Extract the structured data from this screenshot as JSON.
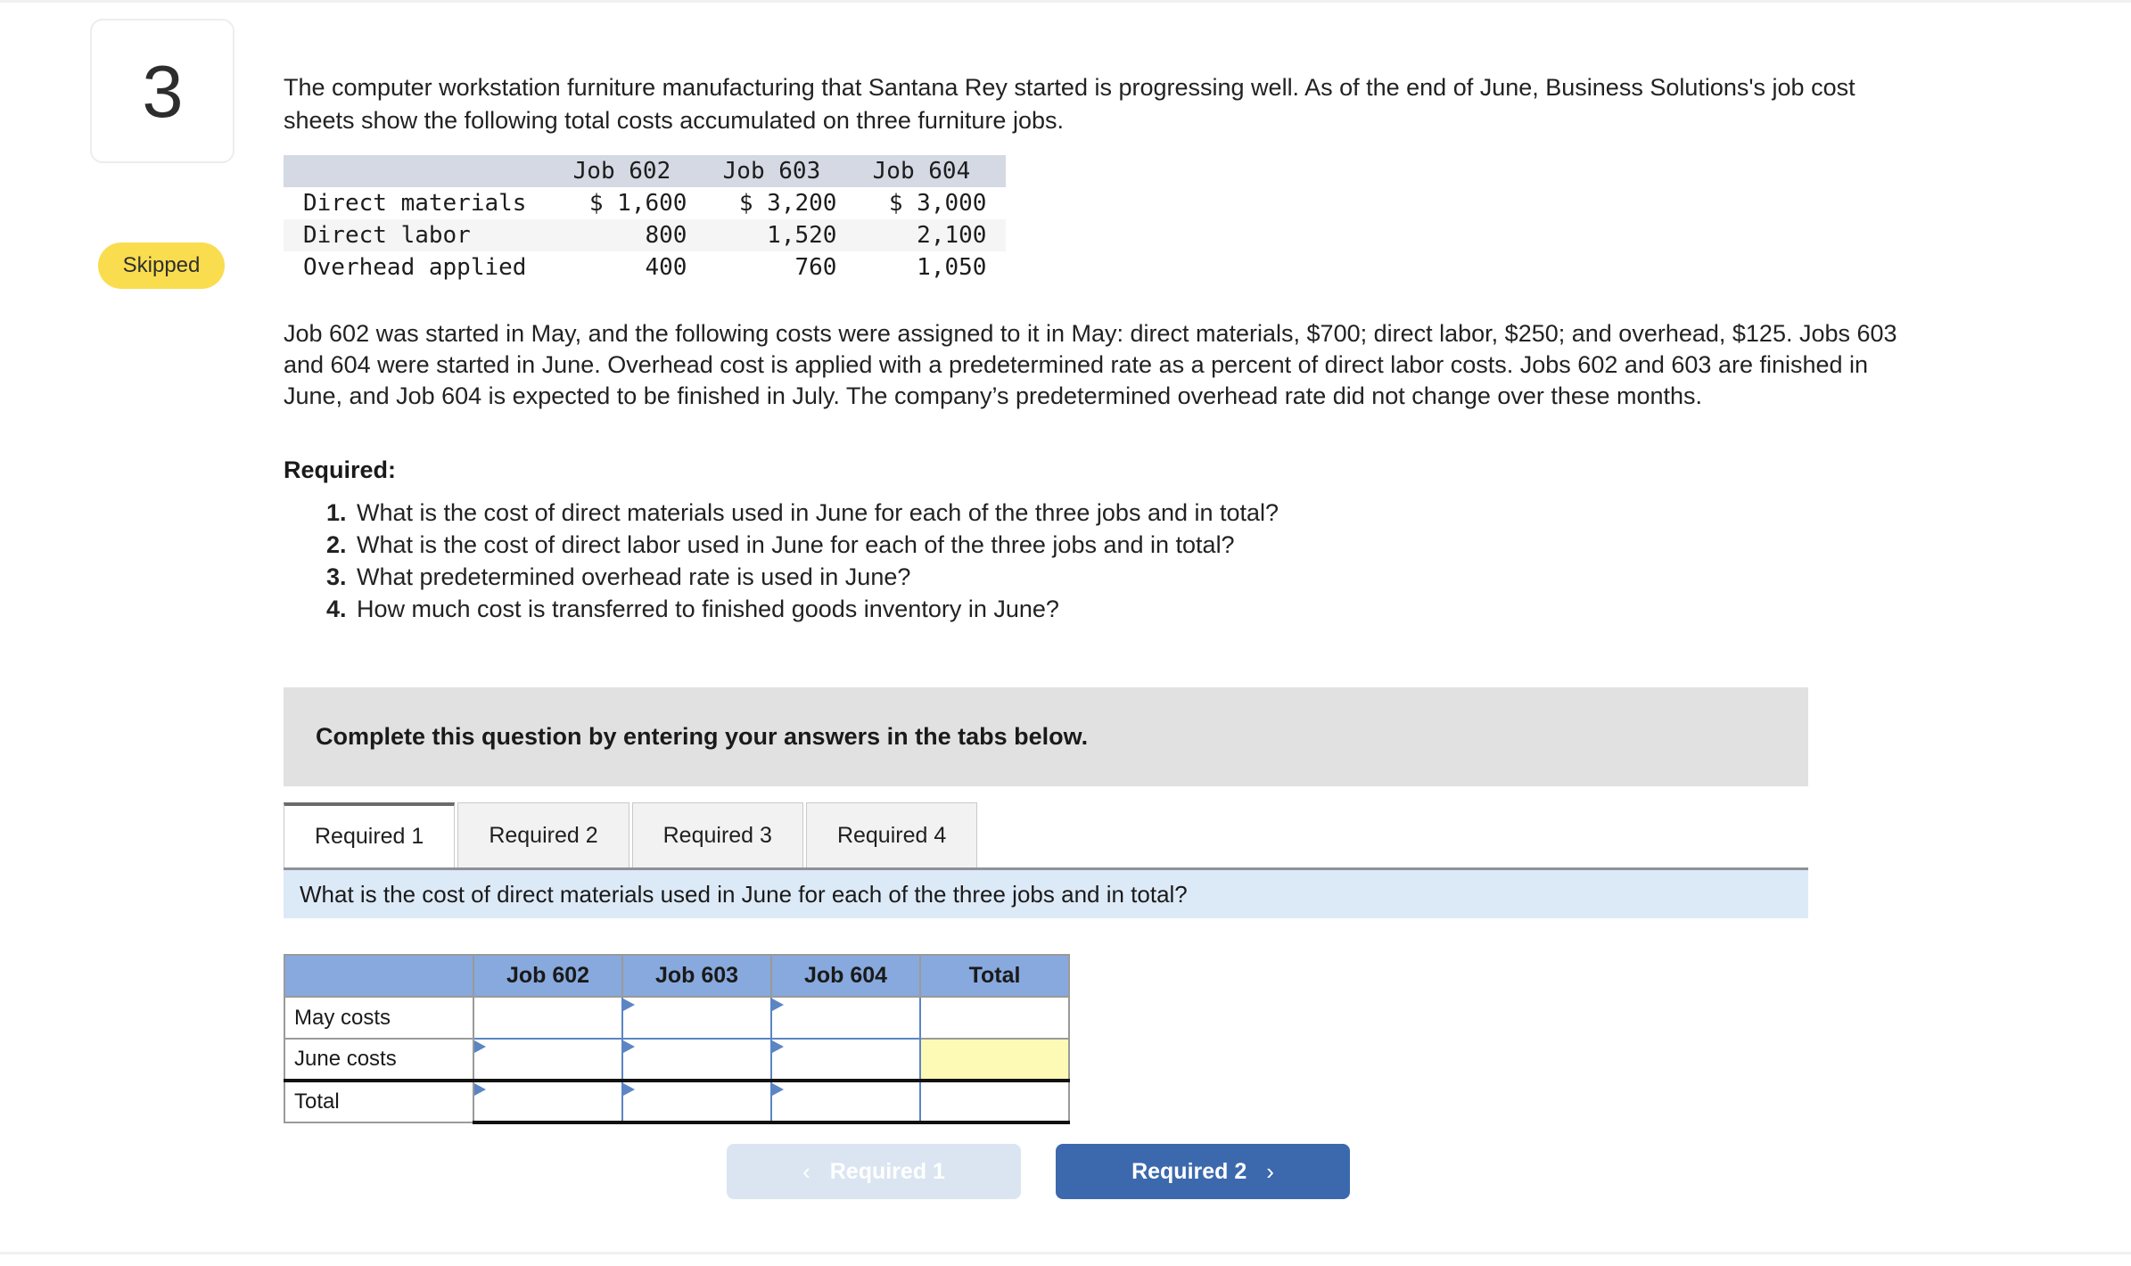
{
  "question": {
    "number": "3",
    "status_label": "Skipped"
  },
  "intro_paragraph": "The computer workstation furniture manufacturing that Santana Rey started is progressing well. As of the end of June, Business Solutions's job cost sheets show the following total costs accumulated on three furniture jobs.",
  "cost_table": {
    "headers": [
      "",
      "Job 602",
      "Job 603",
      "Job 604"
    ],
    "rows": [
      {
        "label": "Direct materials",
        "values": [
          "$ 1,600",
          "$ 3,200",
          "$ 3,000"
        ]
      },
      {
        "label": "Direct labor",
        "values": [
          "800",
          "1,520",
          "2,100"
        ]
      },
      {
        "label": "Overhead applied",
        "values": [
          "400",
          "760",
          "1,050"
        ]
      }
    ]
  },
  "body_paragraph": "Job 602 was started in May, and the following costs were assigned to it in May: direct materials, $700; direct labor, $250; and overhead, $125. Jobs 603 and 604 were started in June. Overhead cost is applied with a predetermined rate as a percent of direct labor costs. Jobs 602 and 603 are finished in June, and Job 604 is expected to be finished in July. The company’s predetermined overhead rate did not change over these months.",
  "required": {
    "heading": "Required:",
    "items": [
      {
        "mark": "1.",
        "text": "What is the cost of direct materials used in June for each of the three jobs and in total?"
      },
      {
        "mark": "2.",
        "text": "What is the cost of direct labor used in June for each of the three jobs and in total?"
      },
      {
        "mark": "3.",
        "text": "What predetermined overhead rate is used in June?"
      },
      {
        "mark": "4.",
        "text": "How much cost is transferred to finished goods inventory in June?"
      }
    ]
  },
  "instruction_banner": "Complete this question by entering your answers in the tabs below.",
  "tabs": [
    {
      "label": "Required 1",
      "active": true
    },
    {
      "label": "Required 2",
      "active": false
    },
    {
      "label": "Required 3",
      "active": false
    },
    {
      "label": "Required 4",
      "active": false
    }
  ],
  "question_bar": "What is the cost of direct materials used in June for each of the three jobs and in total?",
  "answer_table": {
    "headers": [
      "",
      "Job 602",
      "Job 603",
      "Job 604",
      "Total"
    ],
    "rows": [
      {
        "label": "May costs",
        "cells": [
          "",
          "",
          "",
          ""
        ]
      },
      {
        "label": "June costs",
        "cells": [
          "",
          "",
          "",
          ""
        ]
      },
      {
        "label": "Total",
        "cells": [
          "",
          "",
          "",
          ""
        ]
      }
    ]
  },
  "nav": {
    "prev_label": "Required 1",
    "next_label": "Required 2",
    "prev_chevron": "‹",
    "next_chevron": "›"
  },
  "colors": {
    "header_blue": "#87a9dd",
    "input_border_blue": "#5b85c4",
    "highlight_yellow": "#fcfab4",
    "question_bar_blue": "#dce9f7",
    "instruction_gray": "#e1e1e1",
    "skipped_yellow": "#f9dd4e",
    "next_button_blue": "#3c69ad",
    "prev_button_blue": "#dbe5f1"
  }
}
